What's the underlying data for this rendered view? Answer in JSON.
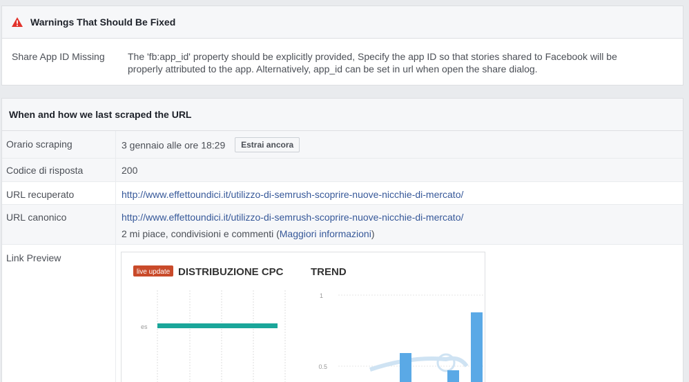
{
  "warnings": {
    "title": "Warnings That Should Be Fixed",
    "items": [
      {
        "label": "Share App ID Missing",
        "message": "The 'fb:app_id' property should be explicitly provided, Specify the app ID so that stories shared to Facebook will be properly attributed to the app. Alternatively, app_id can be set in url when open the share dialog."
      }
    ]
  },
  "scrape": {
    "title": "When and how we last scraped the URL",
    "rows": {
      "time": {
        "label": "Orario scraping",
        "value": "3 gennaio alle ore 18:29",
        "button": "Estrai ancora"
      },
      "response": {
        "label": "Codice di risposta",
        "value": "200"
      },
      "fetched": {
        "label": "URL recuperato",
        "value": "http://www.effettoundici.it/utilizzo-di-semrush-scoprire-nuove-nicchie-di-mercato/"
      },
      "canonical": {
        "label": "URL canonico",
        "value": "http://www.effettoundici.it/utilizzo-di-semrush-scoprire-nuove-nicchie-di-mercato/",
        "likes_prefix": "2 mi piace, condivisioni e commenti (",
        "likes_link": "Maggiori informazioni",
        "likes_suffix": ")"
      },
      "preview": {
        "label": "Link Preview"
      }
    }
  },
  "preview_image": {
    "badge": "live update",
    "left_title": "DISTRIBUZIONE CPC",
    "right_title": "TREND",
    "left_tick": "es",
    "tick_top": "1",
    "tick_mid": "0.5",
    "badge_color": "#c94a2a",
    "bar_color": "#1aa69a",
    "trend_color": "#5aa9e6"
  }
}
